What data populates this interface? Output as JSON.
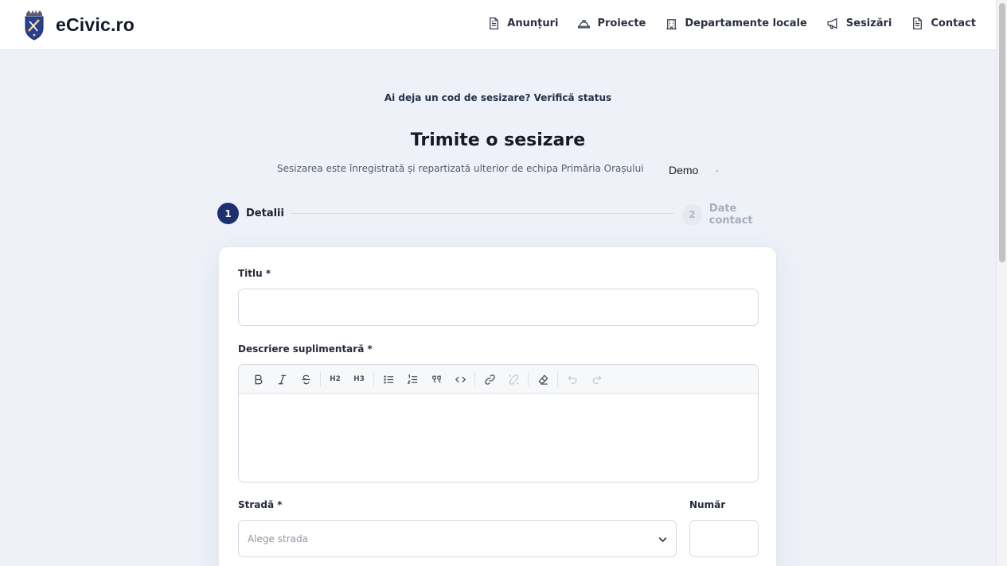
{
  "header": {
    "brand": "eCivic.ro",
    "nav": [
      {
        "label": "Anunțuri",
        "icon": "document-icon"
      },
      {
        "label": "Proiecte",
        "icon": "hard-hat-icon"
      },
      {
        "label": "Departamente locale",
        "icon": "building-icon"
      },
      {
        "label": "Sesizări",
        "icon": "megaphone-icon"
      },
      {
        "label": "Contact",
        "icon": "document-icon"
      }
    ]
  },
  "verify_link": "Ai deja un cod de sesizare? Verifică status",
  "page_title": "Trimite o sesizare",
  "subtitle": {
    "text": "Sesizarea este înregistrată și repartizată ulterior de echipa Primăria Orașului",
    "city": "Demo",
    "dot": "."
  },
  "stepper": {
    "steps": [
      {
        "number": "1",
        "label": "Detalii",
        "active": true
      },
      {
        "number": "2",
        "label": "Date contact",
        "active": false
      }
    ]
  },
  "form": {
    "title_label": "Titlu *",
    "title_value": "",
    "description_label": "Descriere suplimentară *",
    "toolbar": [
      "bold-icon",
      "italic-icon",
      "strikethrough-icon",
      "heading-2-icon",
      "heading-3-icon",
      "bullet-list-icon",
      "ordered-list-icon",
      "quote-icon",
      "code-icon",
      "link-icon",
      "unlink-icon",
      "clear-format-icon",
      "undo-icon",
      "redo-icon"
    ],
    "h2_label": "H2",
    "h3_label": "H3",
    "street_label": "Stradă *",
    "street_placeholder": "Alege strada",
    "number_label": "Număr",
    "number_value": ""
  },
  "colors": {
    "accent": "#1e2f6f",
    "background": "#eef1f8"
  }
}
